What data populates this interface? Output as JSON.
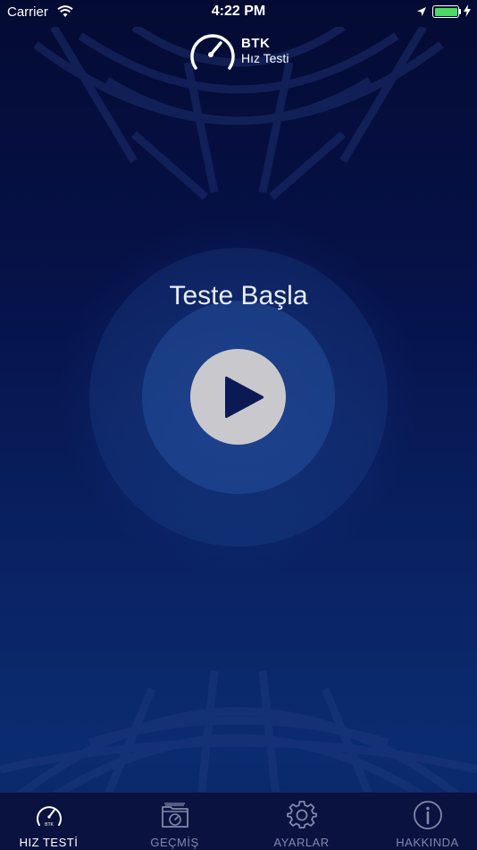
{
  "status_bar": {
    "carrier": "Carrier",
    "time": "4:22 PM",
    "battery_level": 1.0
  },
  "logo": {
    "brand": "BTK",
    "subtitle": "Hız Testi"
  },
  "main": {
    "title": "Teste Başla"
  },
  "tabs": [
    {
      "label": "HIZ TESTİ",
      "icon": "speedometer-icon",
      "active": true
    },
    {
      "label": "GEÇMİŞ",
      "icon": "history-folder-icon",
      "active": false
    },
    {
      "label": "AYARLAR",
      "icon": "gear-icon",
      "active": false
    },
    {
      "label": "HAKKINDA",
      "icon": "info-icon",
      "active": false
    }
  ],
  "colors": {
    "background_top": "#040b33",
    "background_bottom": "#0b2b70",
    "play_button": "#c9c9cd",
    "play_icon": "#0b1a55",
    "battery": "#4cd964",
    "tab_bar": "#0a1240"
  }
}
